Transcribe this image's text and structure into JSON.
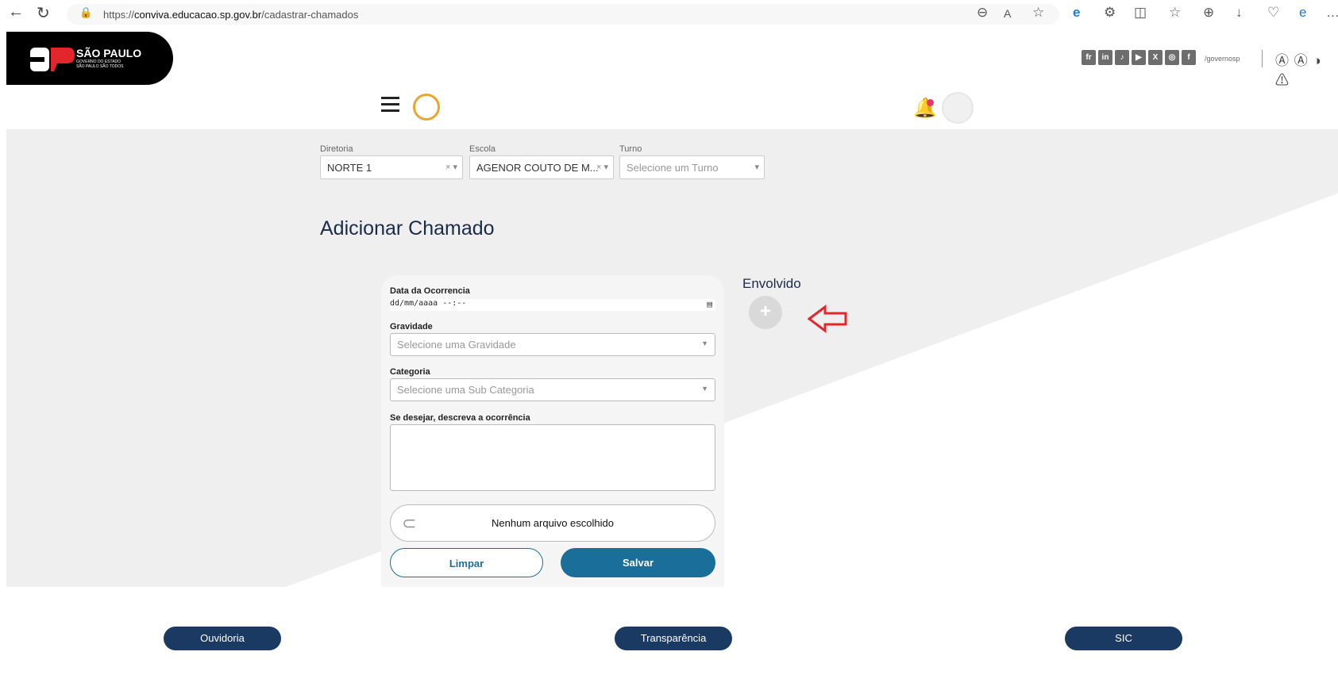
{
  "browser": {
    "url_prefix": "https://",
    "url_domain": "conviva.educacao.sp.gov.br",
    "url_path": "/cadastrar-chamados"
  },
  "header": {
    "brand_title": "SÃO PAULO",
    "brand_sub1": "GOVERNO DO ESTADO",
    "brand_sub2": "SÃO PAULO SÃO TODOS",
    "social_icons": [
      "fr",
      "in",
      "tiktok",
      "youtube",
      "x",
      "instagram",
      "facebook"
    ],
    "social_handle": "/governosp",
    "notification_count": "1"
  },
  "filters": {
    "diretoria": {
      "label": "Diretoria",
      "value": "NORTE 1"
    },
    "escola": {
      "label": "Escola",
      "value": "AGENOR COUTO DE M..."
    },
    "turno": {
      "label": "Turno",
      "placeholder": "Selecione um Turno"
    }
  },
  "form": {
    "title": "Adicionar Chamado",
    "date_label": "Data da Ocorrencia",
    "date_placeholder": "dd/mm/aaaa --:--",
    "gravidade_label": "Gravidade",
    "gravidade_placeholder": "Selecione uma Gravidade",
    "categoria_label": "Categoria",
    "categoria_placeholder": "Selecione uma Sub Categoria",
    "descricao_label": "Se desejar, descreva a ocorrência",
    "file_text": "Nenhum arquivo escolhido",
    "clear_label": "Limpar",
    "save_label": "Salvar"
  },
  "envolvido": {
    "label": "Envolvido",
    "add": "+"
  },
  "footer": {
    "ouvidoria": "Ouvidoria",
    "transparencia": "Transparência",
    "sic": "SIC"
  },
  "colors": {
    "primary": "#1a6e9a",
    "footer": "#1b3a63",
    "arrow": "#e3262b",
    "badge": "#e8336b"
  }
}
